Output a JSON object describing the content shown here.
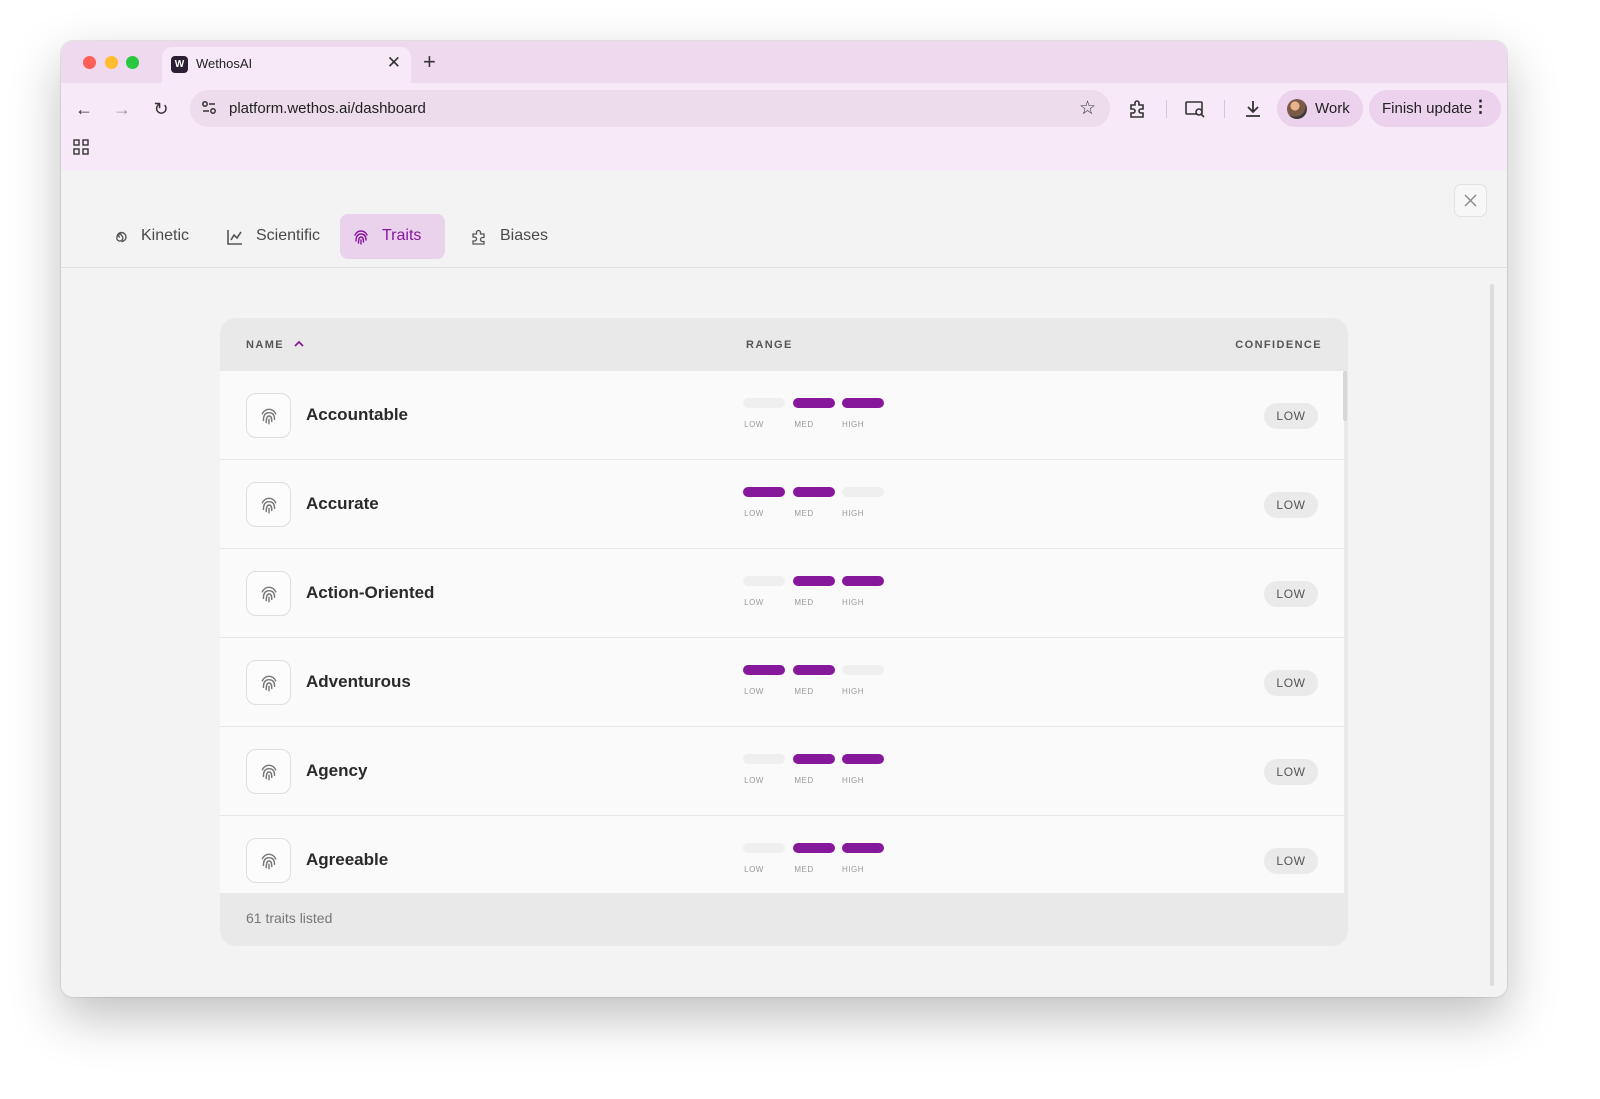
{
  "browser": {
    "tab_title": "WethosAI",
    "tab_favicon": "W",
    "url": "platform.wethos.ai/dashboard",
    "profile_label": "Work",
    "update_label": "Finish update"
  },
  "nav": {
    "tabs": [
      {
        "label": "Kinetic",
        "icon": "spiral-icon",
        "active": false
      },
      {
        "label": "Scientific",
        "icon": "chart-icon",
        "active": false
      },
      {
        "label": "Traits",
        "icon": "fingerprint-icon",
        "active": true
      },
      {
        "label": "Biases",
        "icon": "puzzle-icon",
        "active": false
      }
    ]
  },
  "table": {
    "headers": {
      "name": "NAME",
      "range": "RANGE",
      "confidence": "CONFIDENCE"
    },
    "range_labels": [
      "LOW",
      "MED",
      "HIGH"
    ],
    "rows": [
      {
        "name": "Accountable",
        "range": [
          false,
          true,
          true
        ],
        "confidence": "LOW"
      },
      {
        "name": "Accurate",
        "range": [
          true,
          true,
          false
        ],
        "confidence": "LOW"
      },
      {
        "name": "Action-Oriented",
        "range": [
          false,
          true,
          true
        ],
        "confidence": "LOW"
      },
      {
        "name": "Adventurous",
        "range": [
          true,
          true,
          false
        ],
        "confidence": "LOW"
      },
      {
        "name": "Agency",
        "range": [
          false,
          true,
          true
        ],
        "confidence": "LOW"
      },
      {
        "name": "Agreeable",
        "range": [
          false,
          true,
          true
        ],
        "confidence": "LOW"
      }
    ],
    "footer": "61 traits listed"
  },
  "colors": {
    "accent": "#86199b",
    "accent_bg": "#ead1ec",
    "segment_off": "#efefef"
  }
}
